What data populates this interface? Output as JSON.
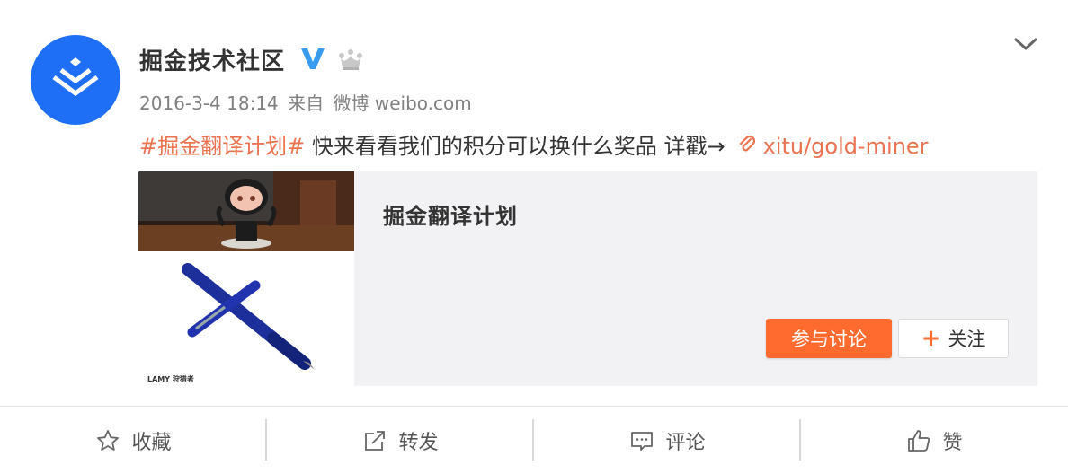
{
  "post": {
    "author": "掘金技术社区",
    "meta": {
      "timestamp": "2016-3-4 18:14",
      "source_prefix": "来自",
      "source_app": "微博 weibo.com"
    },
    "text": {
      "hashtag": "#掘金翻译计划#",
      "body": " 快来看看我们的积分可以换什么奖品  详戳→",
      "link_text": "xitu/gold-miner"
    },
    "card": {
      "title": "掘金翻译计划",
      "thumb_caption": "LAMY 狩猎者",
      "join_label": "参与讨论",
      "follow_label": "关注"
    }
  },
  "actions": [
    {
      "label": "收藏",
      "icon": "star-icon"
    },
    {
      "label": "转发",
      "icon": "share-icon"
    },
    {
      "label": "评论",
      "icon": "comment-icon"
    },
    {
      "label": "赞",
      "icon": "thumbs-up-icon"
    }
  ],
  "colors": {
    "accent": "#eb7350",
    "button_orange": "#ff6b2e",
    "avatar_blue": "#1e6ff5",
    "verified_blue": "#3a9cf0"
  }
}
